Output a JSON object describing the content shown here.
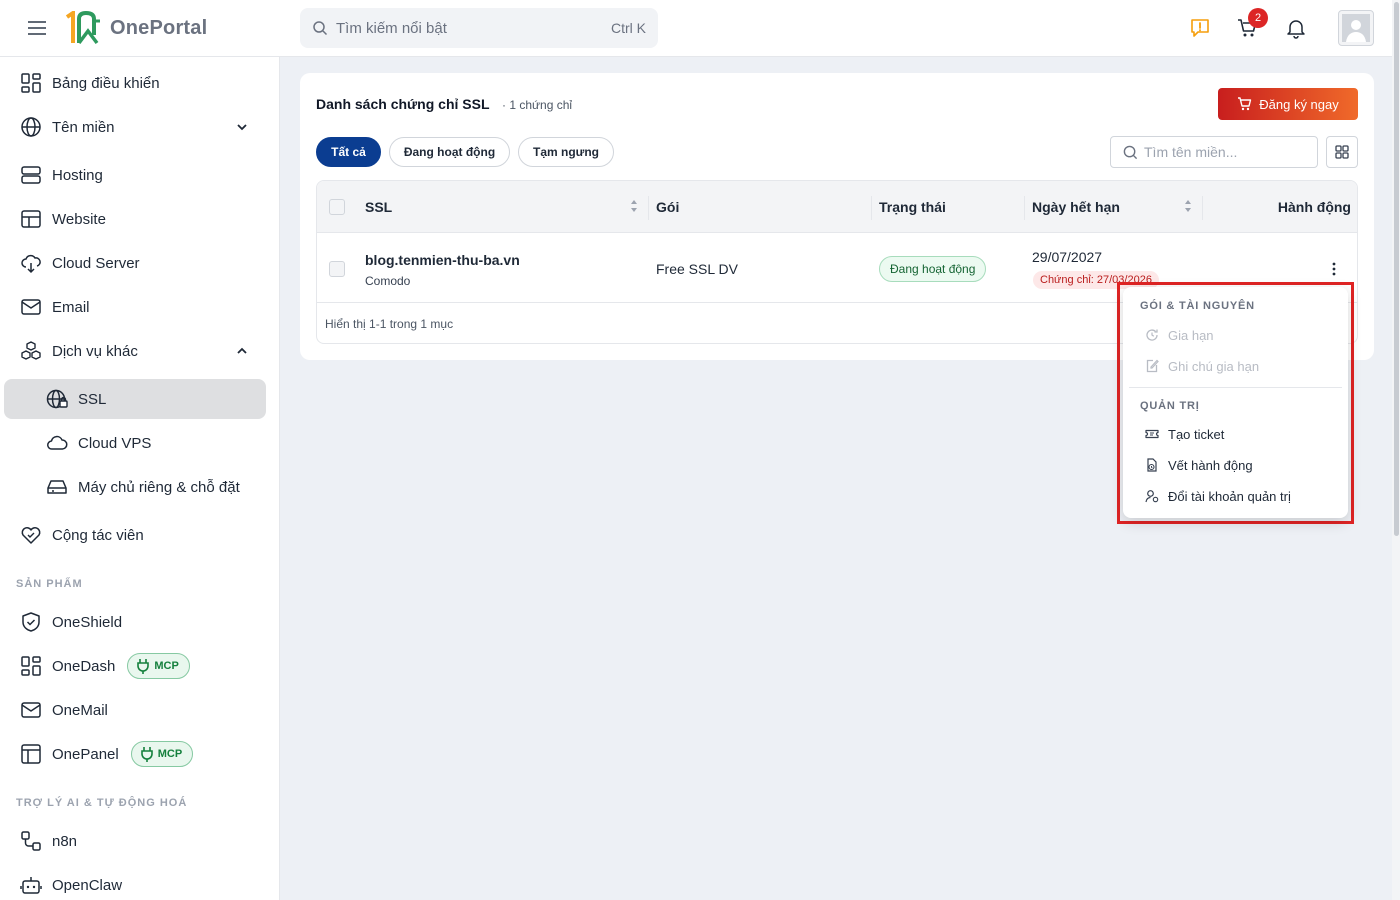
{
  "header": {
    "app_name": "OnePortal",
    "search_placeholder": "Tìm kiếm nổi bật",
    "search_shortcut": "Ctrl K",
    "cart_count": "2"
  },
  "sidebar": {
    "items": [
      {
        "label": "Bảng điều khiển"
      },
      {
        "label": "Tên miền"
      },
      {
        "label": "Hosting"
      },
      {
        "label": "Website"
      },
      {
        "label": "Cloud Server"
      },
      {
        "label": "Email"
      },
      {
        "label": "Dịch vụ khác"
      },
      {
        "label": "SSL"
      },
      {
        "label": "Cloud VPS"
      },
      {
        "label": "Máy chủ riêng & chỗ đặt"
      },
      {
        "label": "Cộng tác viên"
      }
    ],
    "section_products": "SẢN PHẨM",
    "products": [
      {
        "label": "OneShield"
      },
      {
        "label": "OneDash",
        "badge": "MCP"
      },
      {
        "label": "OneMail"
      },
      {
        "label": "OnePanel",
        "badge": "MCP"
      }
    ],
    "section_ai": "TRỢ LÝ AI & TỰ ĐỘNG HOÁ",
    "ai": [
      {
        "label": "n8n"
      },
      {
        "label": "OpenClaw"
      }
    ]
  },
  "main": {
    "title": "Danh sách chứng chỉ SSL",
    "count": "· 1 chứng chỉ",
    "register_label": "Đăng ký ngay",
    "tabs": [
      {
        "label": "Tất cả"
      },
      {
        "label": "Đang hoạt động"
      },
      {
        "label": "Tạm ngưng"
      }
    ],
    "domain_search_placeholder": "Tìm tên miền...",
    "columns": [
      "SSL",
      "Gói",
      "Trạng thái",
      "Ngày hết hạn",
      "Hành động"
    ],
    "rows": [
      {
        "domain": "blog.tenmien-thu-ba.vn",
        "provider": "Comodo",
        "package": "Free SSL DV",
        "status": "Đang hoạt động",
        "expiry": "29/07/2027",
        "cert_expiry": "Chứng chỉ: 27/03/2026"
      }
    ],
    "footer": "Hiển thị 1-1 trong 1 mục"
  },
  "menu": {
    "section1": "GÓI & TÀI NGUYÊN",
    "renew": "Gia hạn",
    "renew_note": "Ghi chú gia hạn",
    "section2": "QUẢN TRỊ",
    "create_ticket": "Tạo ticket",
    "action_log": "Vết hành động",
    "switch_admin": "Đổi tài khoản quản trị"
  }
}
